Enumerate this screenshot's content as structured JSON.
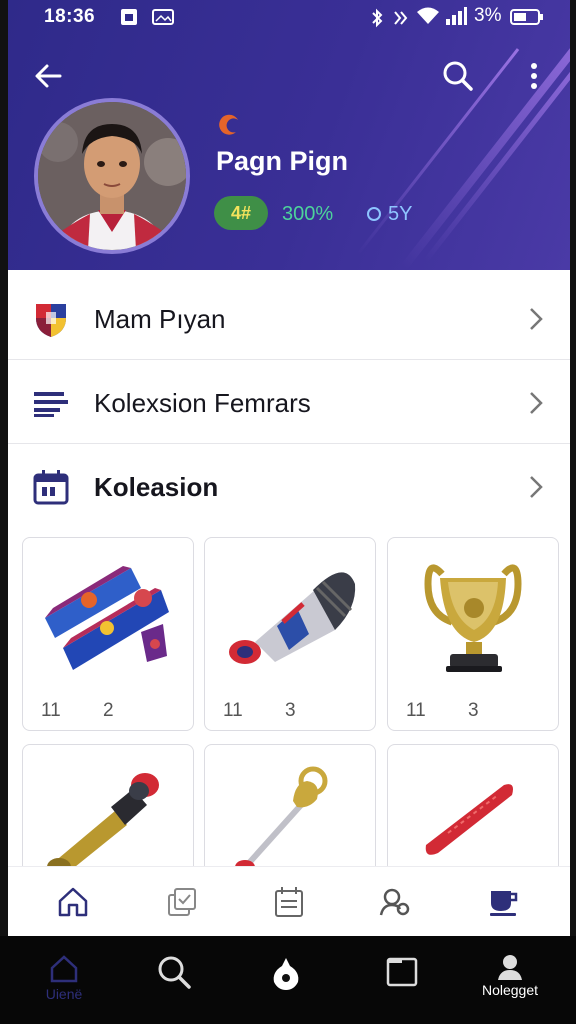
{
  "status_bar": {
    "time": "18:36",
    "battery_text": "3%"
  },
  "header": {
    "back_icon": "arrow-left-icon",
    "search_icon": "search-icon",
    "menu_icon": "more-vertical-icon",
    "colors": {
      "bg": "#3a2f96",
      "accent": "#e5642a"
    }
  },
  "profile": {
    "name": "Pagn Pign",
    "badge": "4#",
    "stat_percent": "300%",
    "stat_year": "5Y"
  },
  "menu": [
    {
      "label": "Mam Pıyan",
      "icon": "club-crest-icon"
    },
    {
      "label": "Kolexsion Femrars",
      "icon": "list-lines-icon"
    },
    {
      "label": "Koleasion",
      "icon": "calendar-icon"
    }
  ],
  "collection": [
    {
      "item": "scarf-icon",
      "left": "11",
      "right": "2"
    },
    {
      "item": "goal-torch-icon",
      "left": "11",
      "right": "3"
    },
    {
      "item": "trophy-cup-icon",
      "left": "11",
      "right": "3"
    },
    {
      "item": "golden-torch-icon",
      "left": "",
      "right": ""
    },
    {
      "item": "golden-key-icon",
      "left": "",
      "right": ""
    },
    {
      "item": "red-scarf-icon",
      "left": "",
      "right": ""
    }
  ],
  "bottom_nav": [
    {
      "icon": "home-icon"
    },
    {
      "icon": "cards-icon"
    },
    {
      "icon": "calendar-icon"
    },
    {
      "icon": "people-icon"
    },
    {
      "icon": "cup-icon"
    }
  ],
  "system_nav": [
    {
      "icon": "home-icon",
      "label": "Uienë"
    },
    {
      "icon": "search-icon",
      "label": ""
    },
    {
      "icon": "ball-icon",
      "label": ""
    },
    {
      "icon": "square-icon",
      "label": ""
    },
    {
      "icon": "person-icon",
      "label": "Nolegget"
    }
  ]
}
